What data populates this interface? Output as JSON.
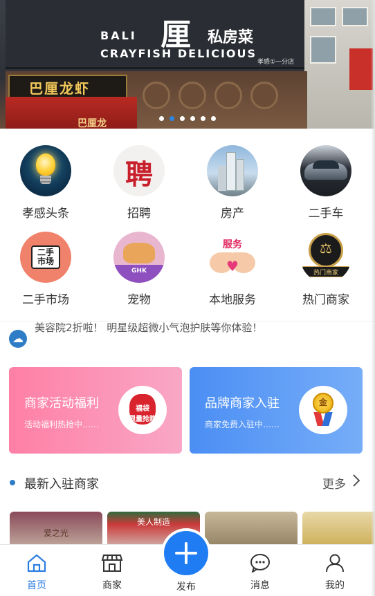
{
  "banner": {
    "sign_en_line1": "BALI",
    "sign_en_line2": "CRAYFISH DELICIOUS",
    "sign_logo": "厘",
    "sign_cn": "私房菜",
    "sign_small": "孝感①一分店",
    "lower_sign": "巴厘龙虾",
    "red_strip": "巴厘龙",
    "slide_count": 6,
    "active_slide": 2
  },
  "categories": [
    {
      "label": "孝感头条",
      "icon": "lightbulb-icon"
    },
    {
      "label": "招聘",
      "icon": "hiring-icon",
      "glyph": "聘"
    },
    {
      "label": "房产",
      "icon": "buildings-icon"
    },
    {
      "label": "二手车",
      "icon": "car-icon"
    },
    {
      "label": "二手市场",
      "icon": "market-icon",
      "glyph": "二手\n市场"
    },
    {
      "label": "宠物",
      "icon": "pets-icon",
      "glyph": "GHK"
    },
    {
      "label": "本地服务",
      "icon": "service-icon",
      "glyph": "服务"
    },
    {
      "label": "热门商家",
      "icon": "hot-merchant-icon",
      "glyph": "热门商家"
    }
  ],
  "notice": {
    "text": "美容院2折啦！ 明星级超微小气泡护肤等你体验！"
  },
  "promos": [
    {
      "title": "商家活动福利",
      "subtitle": "活动福利热抢中……",
      "badge_text": "福袋\n限量抢购",
      "color": "#ff7fa6"
    },
    {
      "title": "品牌商家入驻",
      "subtitle": "商家免费入驻中……",
      "badge_text": "金",
      "color": "#4b8ef4"
    }
  ],
  "section": {
    "title": "最新入驻商家",
    "more": "更多",
    "thumbs": [
      {
        "text": "爱之光"
      },
      {
        "text": "美人制造"
      },
      {
        "text": ""
      },
      {
        "text": ""
      }
    ]
  },
  "tabbar": {
    "home": "首页",
    "merchants": "商家",
    "publish": "发布",
    "messages": "消息",
    "mine": "我的"
  },
  "colors": {
    "accent": "#1f7cf2",
    "active_tab": "#2b7de0",
    "promo_pink": "#ff7fa6",
    "promo_blue": "#4b8ef4"
  }
}
